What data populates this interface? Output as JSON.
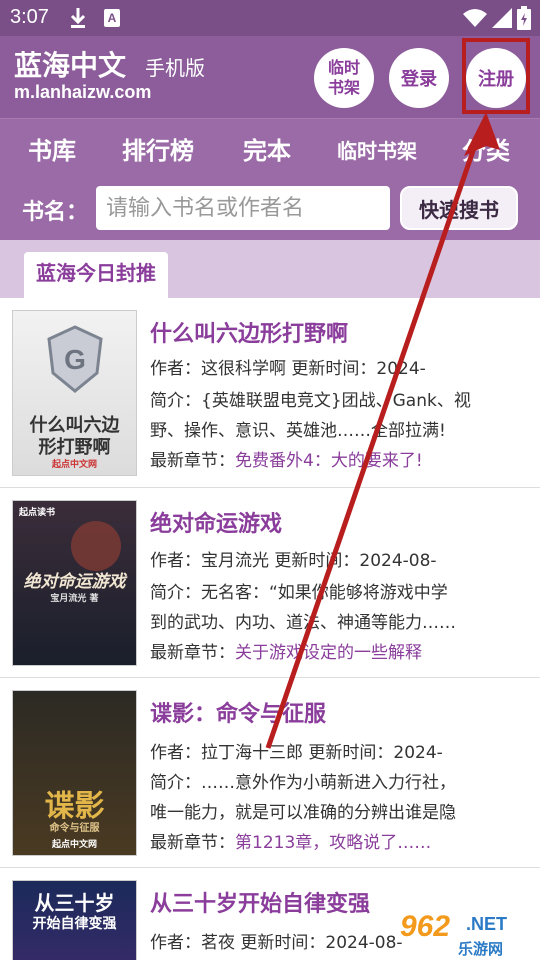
{
  "status_bar": {
    "time": "3:07",
    "notification_letter": "A"
  },
  "header": {
    "site_name": "蓝海中文",
    "mobile_tag": "手机版",
    "url": "m.lanhaizw.com",
    "temp_shelf_label": "临时书架",
    "login_label": "登录",
    "register_label": "注册"
  },
  "nav": {
    "items": [
      {
        "label": "书库"
      },
      {
        "label": "排行榜"
      },
      {
        "label": "完本"
      },
      {
        "label": "临时书架"
      },
      {
        "label": "分类"
      }
    ]
  },
  "search": {
    "label": "书名：",
    "placeholder": "请输入书名或作者名",
    "button_label": "快速搜书"
  },
  "section": {
    "title": "蓝海今日封推"
  },
  "books": [
    {
      "title": "什么叫六边形打野啊",
      "author_line": "作者：这很科学啊    更新时间：2024-",
      "summary_line1": "简介：{英雄联盟电竞文}团战、Gank、视",
      "summary_line2": "野、操作、意识、英雄池……全部拉满!",
      "latest_label": "最新章节：",
      "latest_chapter": "免费番外4：大的要来了!",
      "cover_text1": "什么叫六边",
      "cover_text2": "形打野啊",
      "cover_publisher": "起点中文网"
    },
    {
      "title": "绝对命运游戏",
      "author_line": "作者：宝月流光    更新时间：2024-08-",
      "summary_line1": "简介：无名客：“如果你能够将游戏中学",
      "summary_line2": "到的武功、内功、道法、神通等能力……",
      "latest_label": "最新章节：",
      "latest_chapter": "关于游戏设定的一些解释",
      "cover_text1": "绝对命运游戏",
      "cover_text2": "宝月流光 著",
      "cover_publisher": "起点读书"
    },
    {
      "title": "谍影：命令与征服",
      "author_line": "作者：拉丁海十三郎    更新时间：2024-",
      "summary_line1": "简介：……意外作为小萌新进入力行社，",
      "summary_line2": "唯一能力，就是可以准确的分辨出谁是隐",
      "latest_label": "最新章节：",
      "latest_chapter": "第1213章，攻略说了……",
      "cover_text1": "谍影",
      "cover_text2": "命令与征服",
      "cover_publisher": "起点中文网"
    },
    {
      "title": "从三十岁开始自律变强",
      "author_line": "作者：茗夜    更新时间：2024-08-",
      "cover_text1": "从三十岁",
      "cover_text2": "开始自律变强"
    }
  ],
  "watermark": {
    "number": "962",
    "net": ".NET",
    "cn": "乐游网"
  },
  "colors": {
    "header": "#8c5d9a",
    "nav": "#9b6ba7",
    "accent": "#8a3d9b",
    "annotation": "#b81e1e"
  }
}
